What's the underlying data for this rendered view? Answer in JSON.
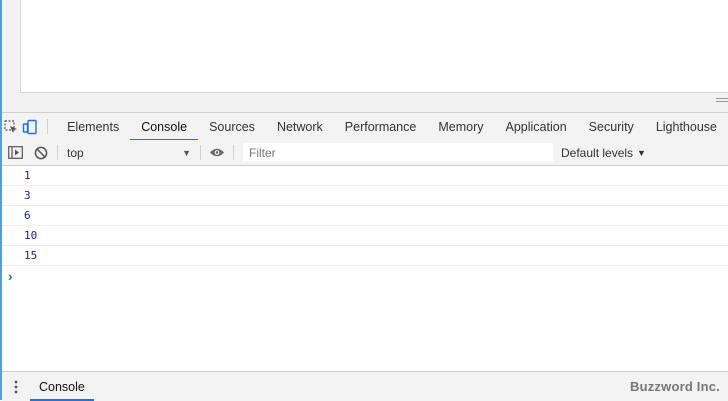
{
  "devtools": {
    "tabs": [
      "Elements",
      "Console",
      "Sources",
      "Network",
      "Performance",
      "Memory",
      "Application",
      "Security",
      "Lighthouse"
    ],
    "active_tab": "Console",
    "toolbar": {
      "context": "top",
      "filter_placeholder": "Filter",
      "levels": "Default levels",
      "dropdown_arrow": "▼"
    },
    "console_logs": [
      "1",
      "3",
      "6",
      "10",
      "15"
    ],
    "prompt_symbol": "›",
    "drawer": {
      "tab": "Console",
      "watermark": "Buzzword Inc."
    }
  },
  "colors": {
    "accent": "#1a73e8",
    "log_number": "#1a1aa6",
    "prompt": "#1a73e8"
  }
}
